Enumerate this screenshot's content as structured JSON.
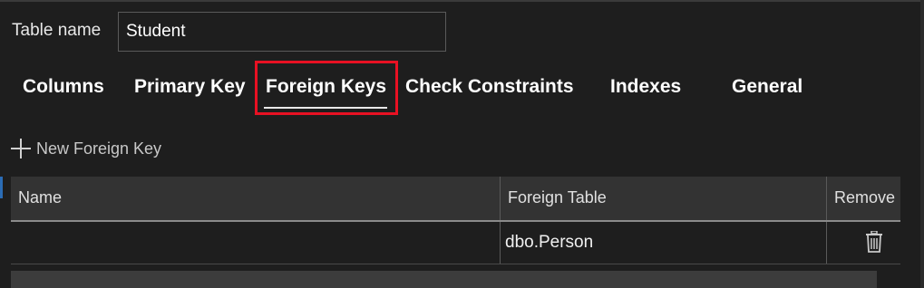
{
  "table_name": {
    "label": "Table name",
    "value": "Student"
  },
  "tabs": [
    {
      "label": "Columns"
    },
    {
      "label": "Primary Key"
    },
    {
      "label": "Foreign Keys",
      "selected": true
    },
    {
      "label": "Check Constraints"
    },
    {
      "label": "Indexes"
    },
    {
      "label": "General"
    }
  ],
  "toolbar": {
    "new_foreign_key_label": "New Foreign Key",
    "new_icon": "plus-icon"
  },
  "grid": {
    "columns": [
      "Name",
      "Foreign Table",
      "Remove"
    ],
    "rows": [
      {
        "name": "",
        "foreign_table": "dbo.Person",
        "remove_icon": "trash-icon"
      }
    ]
  },
  "colors": {
    "background": "#1e1e1e",
    "highlight": "#e81123",
    "header_bg": "#333333"
  }
}
